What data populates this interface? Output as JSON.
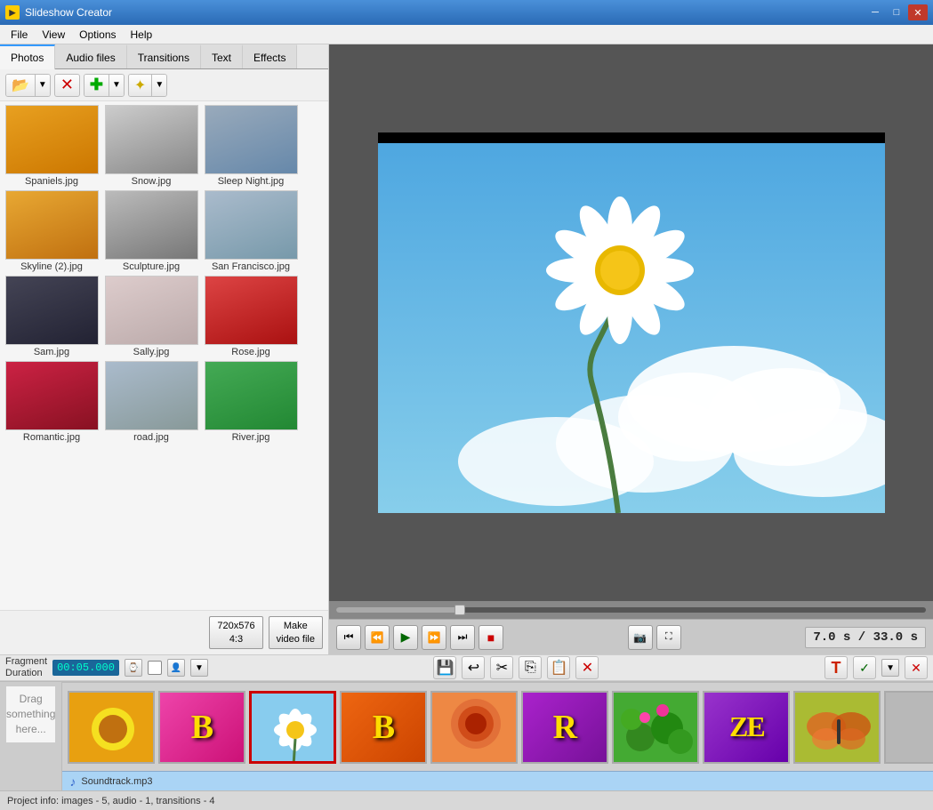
{
  "app": {
    "title": "Slideshow Creator",
    "icon": "▶"
  },
  "titlebar": {
    "min_label": "─",
    "max_label": "□",
    "close_label": "✕"
  },
  "menubar": {
    "items": [
      {
        "label": "File",
        "id": "menu-file"
      },
      {
        "label": "View",
        "id": "menu-view"
      },
      {
        "label": "Options",
        "id": "menu-options"
      },
      {
        "label": "Help",
        "id": "menu-help"
      }
    ]
  },
  "tabs": [
    {
      "label": "Photos",
      "active": true
    },
    {
      "label": "Audio files",
      "active": false
    },
    {
      "label": "Transitions",
      "active": false
    },
    {
      "label": "Text",
      "active": false
    },
    {
      "label": "Effects",
      "active": false
    }
  ],
  "toolbar": {
    "open_icon": "📂",
    "delete_icon": "✕",
    "add_icon": "✚",
    "star_icon": "✦"
  },
  "photos": [
    {
      "name": "Spaniels.jpg",
      "color": "photo-skyline"
    },
    {
      "name": "Snow.jpg",
      "color": "photo-sculpture"
    },
    {
      "name": "Sleep Night.jpg",
      "color": "photo-sanfran"
    },
    {
      "name": "Skyline (2).jpg",
      "color": "photo-skyline"
    },
    {
      "name": "Sculpture.jpg",
      "color": "photo-sculpture"
    },
    {
      "name": "San Francisco.jpg",
      "color": "photo-sanfran"
    },
    {
      "name": "Sam.jpg",
      "color": "photo-sam"
    },
    {
      "name": "Sally.jpg",
      "color": "photo-sally"
    },
    {
      "name": "Rose.jpg",
      "color": "photo-rose"
    },
    {
      "name": "Romantic.jpg",
      "color": "photo-romantic"
    },
    {
      "name": "road.jpg",
      "color": "photo-road"
    },
    {
      "name": "River.jpg",
      "color": "photo-river"
    }
  ],
  "panel_bottom": {
    "size_label": "720x576\n4:3",
    "make_video_label": "Make\nvideo file"
  },
  "preview": {
    "time_current": "7.0 s",
    "time_separator": " / ",
    "time_total": "33.0 s"
  },
  "controls": {
    "prev_start": "⏮",
    "prev_frame": "⏪",
    "play": "▶",
    "next_frame": "⏩",
    "next_end": "⏭",
    "stop": "■",
    "camera": "📷",
    "fullscreen": "⛶"
  },
  "fragment": {
    "label_line1": "Fragment",
    "label_line2": "Duration",
    "time": "00:05.000",
    "face_icon": "👤",
    "arrow_icon": "▼",
    "save_icon": "💾",
    "undo_icon": "↩",
    "cut_icon": "✂",
    "copy_icon": "⎘",
    "paste_icon": "📋",
    "delete_icon": "✕",
    "text_icon": "T",
    "check_icon": "✓",
    "check_arrow": "▼",
    "cancel_icon": "✕"
  },
  "timeline": {
    "items": [
      {
        "type": "photo",
        "color": "tb-yellow",
        "selected": false,
        "label": ""
      },
      {
        "type": "transition",
        "color": "tb-pink",
        "selected": false,
        "label": "B"
      },
      {
        "type": "photo",
        "color": "tb-daisy",
        "selected": true,
        "label": ""
      },
      {
        "type": "transition",
        "color": "tb-orange-b",
        "selected": false,
        "label": "B"
      },
      {
        "type": "photo",
        "color": "tb-rose",
        "selected": false,
        "label": ""
      },
      {
        "type": "transition",
        "color": "tb-purple-r",
        "selected": false,
        "label": "R"
      },
      {
        "type": "photo",
        "color": "tb-green",
        "selected": false,
        "label": ""
      },
      {
        "type": "transition",
        "color": "tb-purple-e",
        "selected": false,
        "label": "E"
      },
      {
        "type": "photo",
        "color": "tb-butterfly",
        "selected": false,
        "label": ""
      },
      {
        "type": "empty",
        "color": "",
        "selected": false,
        "label": ""
      }
    ]
  },
  "soundtrack": {
    "music_icon": "♪",
    "label": "Soundtrack.mp3"
  },
  "drag_area": {
    "label": "Drag\nsomething here..."
  },
  "statusbar": {
    "text": "Project info: images - 5, audio - 1, transitions - 4"
  }
}
